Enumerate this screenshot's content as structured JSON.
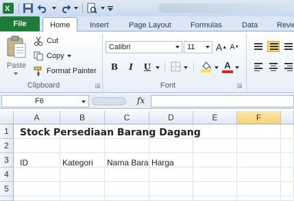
{
  "tabs": {
    "file": "File",
    "items": [
      "Home",
      "Insert",
      "Page Layout",
      "Formulas",
      "Data",
      "Revie"
    ]
  },
  "clipboard": {
    "paste": "Paste",
    "cut": "Cut",
    "copy": "Copy",
    "format_painter": "Format Painter",
    "label": "Clipboard"
  },
  "font": {
    "name": "Calibri",
    "size": "11",
    "bold": "B",
    "italic": "I",
    "underline": "U",
    "grow": "A",
    "shrink": "A",
    "color_letter": "A",
    "label": "Font",
    "fill_color": "#f5e43a",
    "font_color": "#e02020"
  },
  "formula_bar": {
    "name_box": "F6",
    "fx": "fx",
    "value": ""
  },
  "sheet": {
    "columns": [
      "A",
      "B",
      "C",
      "D",
      "E",
      "F"
    ],
    "rows": [
      "1",
      "2",
      "3",
      "4",
      "5"
    ],
    "cells": {
      "A1": "Stock Persediaan Barang Dagang",
      "A3": "ID",
      "B3": "Kategori",
      "C3": "Nama Bara",
      "D3": "Harga"
    }
  },
  "colors": {
    "file_tab": "#1f7b3a",
    "ribbon_bg": "#e6eef8"
  }
}
